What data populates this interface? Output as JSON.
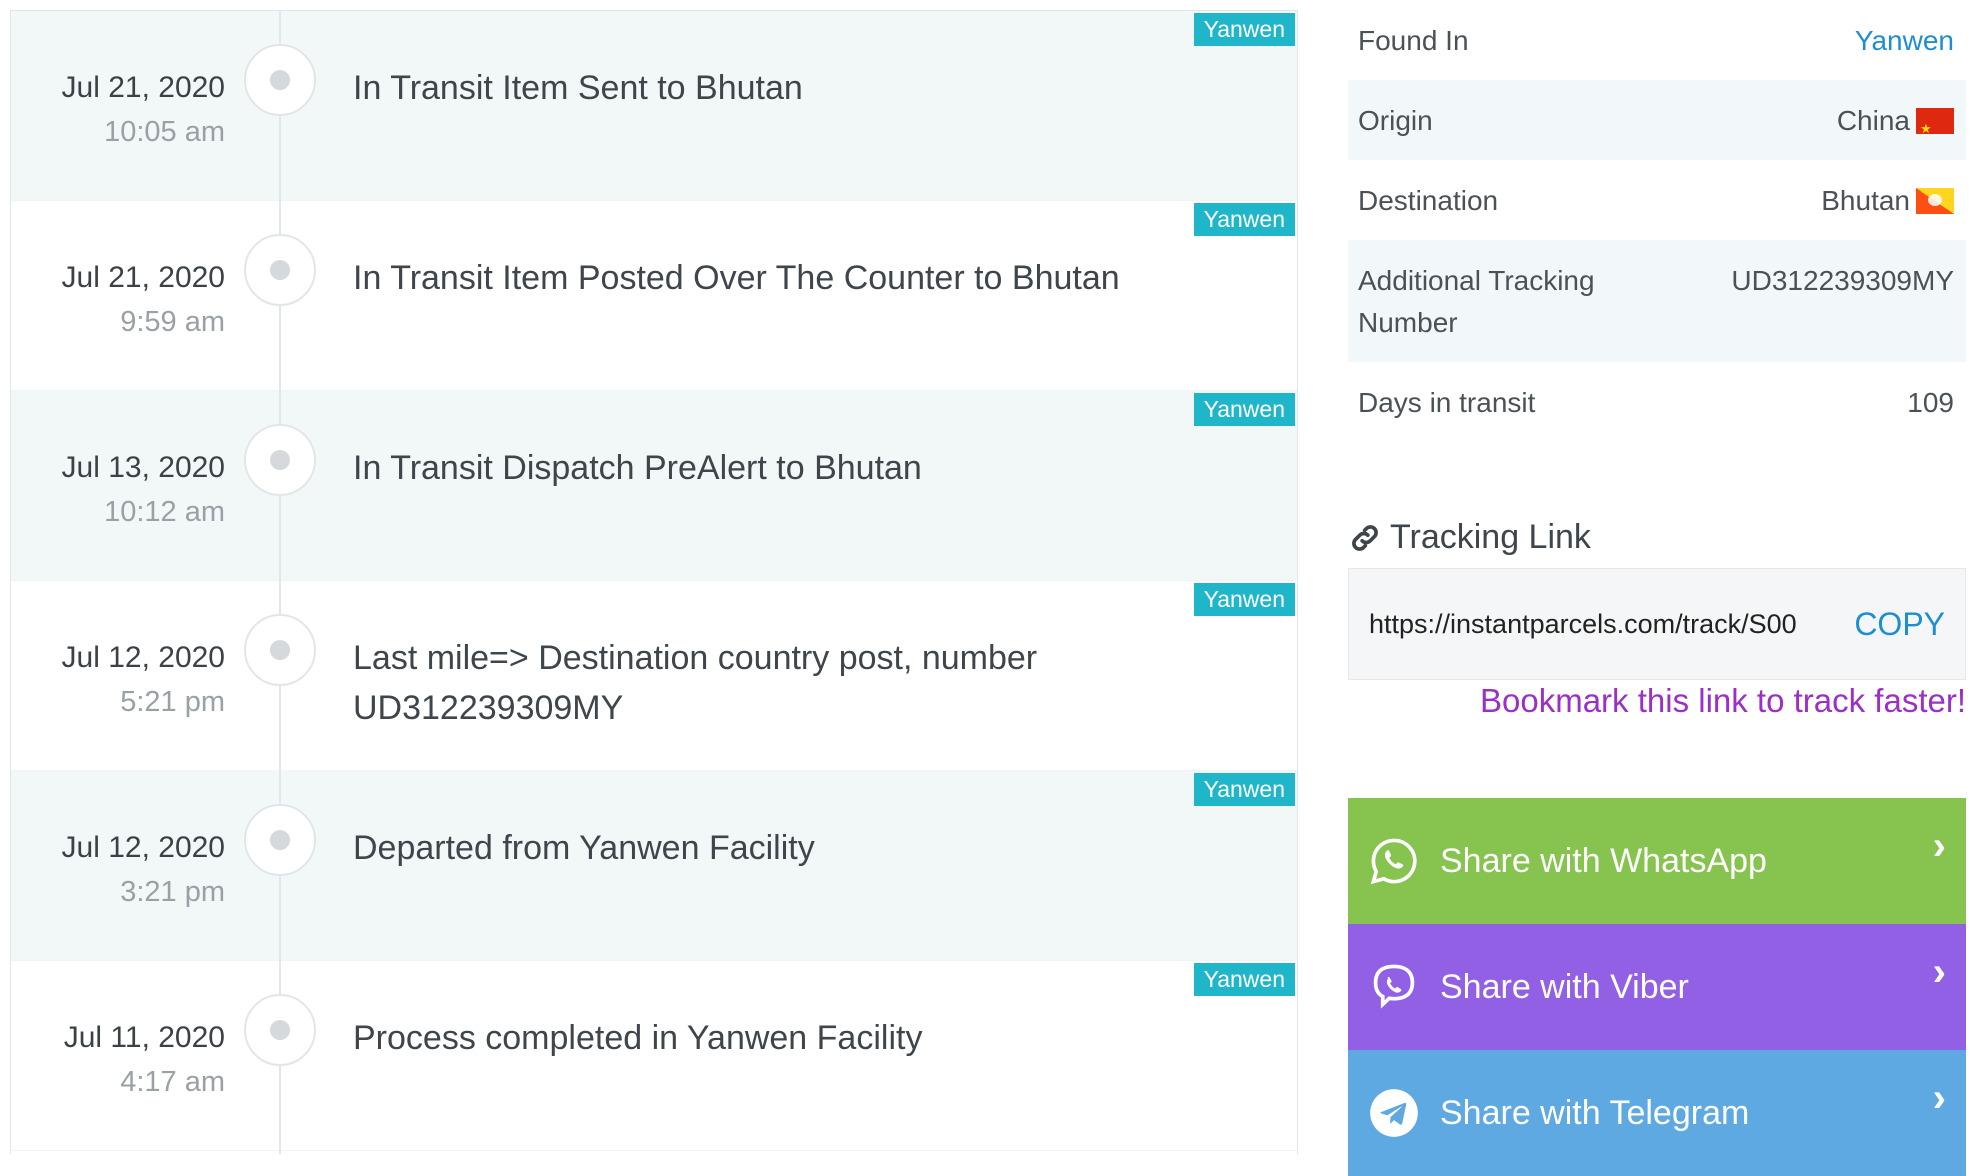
{
  "timeline": {
    "events": [
      {
        "date": "Jul 21, 2020",
        "time": "10:05 am",
        "description": "In Transit Item Sent to Bhutan",
        "carrier": "Yanwen"
      },
      {
        "date": "Jul 21, 2020",
        "time": "9:59 am",
        "description": "In Transit Item Posted Over The Counter to Bhutan",
        "carrier": "Yanwen"
      },
      {
        "date": "Jul 13, 2020",
        "time": "10:12 am",
        "description": "In Transit Dispatch PreAlert to Bhutan",
        "carrier": "Yanwen"
      },
      {
        "date": "Jul 12, 2020",
        "time": "5:21 pm",
        "description": "Last mile=> Destination country post, number UD312239309MY",
        "carrier": "Yanwen"
      },
      {
        "date": "Jul 12, 2020",
        "time": "3:21 pm",
        "description": "Departed from Yanwen Facility",
        "carrier": "Yanwen"
      },
      {
        "date": "Jul 11, 2020",
        "time": "4:17 am",
        "description": "Process completed in Yanwen Facility",
        "carrier": "Yanwen"
      }
    ]
  },
  "details": {
    "found_in": {
      "label": "Found In",
      "value": "Yanwen"
    },
    "origin": {
      "label": "Origin",
      "value": "China",
      "flag": "china-flag"
    },
    "destination": {
      "label": "Destination",
      "value": "Bhutan",
      "flag": "bhutan-flag"
    },
    "additional_tracking": {
      "label": "Additional Tracking Number",
      "value": "UD312239309MY"
    },
    "days_in_transit": {
      "label": "Days in transit",
      "value": "109"
    }
  },
  "tracking_link": {
    "title": "Tracking Link",
    "icon": "link-icon",
    "url": "https://instantparcels.com/track/S00",
    "copy_label": "COPY",
    "bookmark_note": "Bookmark this link to track faster!"
  },
  "share": {
    "whatsapp": {
      "label": "Share with WhatsApp",
      "color": "#86c34f",
      "icon": "whatsapp-icon"
    },
    "viber": {
      "label": "Share with Viber",
      "color": "#9260e4",
      "icon": "viber-icon"
    },
    "telegram": {
      "label": "Share with Telegram",
      "color": "#5fa9e3",
      "icon": "telegram-icon"
    }
  },
  "colors": {
    "badge": "#1fb6c9",
    "link": "#1d8fd1",
    "bookmark": "#9b30c6"
  }
}
